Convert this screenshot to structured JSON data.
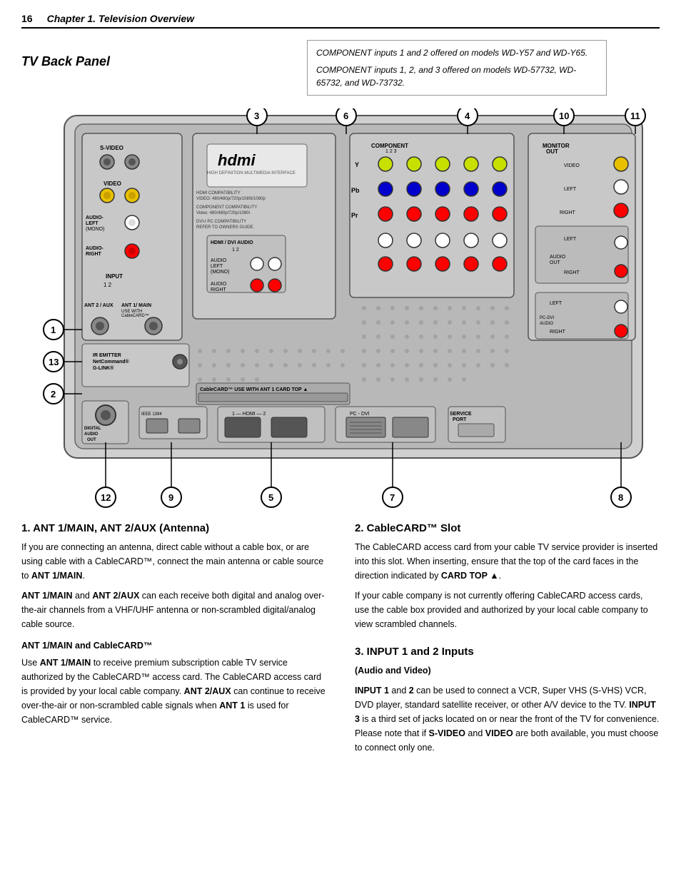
{
  "header": {
    "page_number": "16",
    "chapter_title": "Chapter 1. Television Overview"
  },
  "callout": {
    "line1": "COMPONENT inputs 1 and 2 offered on models WD-Y57 and WD-Y65.",
    "line2": "COMPONENT inputs 1, 2, and 3 offered on models WD-57732, WD-65732, and WD-73732."
  },
  "tv_back_panel": {
    "title": "TV Back Panel"
  },
  "section1": {
    "title": "1.  ANT 1/MAIN, ANT 2/AUX (Antenna)",
    "para1": "If you are connecting an antenna, direct cable without a cable box, or are using cable with a CableCARD™, connect the main antenna or cable source to ANT 1/MAIN.",
    "para2": "ANT 1/MAIN and ANT 2/AUX can each receive both digital and analog over-the-air channels from a VHF/UHF antenna or non-scrambled digital/analog cable source.",
    "subsection_title": "ANT 1/MAIN and CableCARD™",
    "para3": "Use ANT 1/MAIN to receive premium subscription cable TV service authorized by the CableCARD™ access card. The CableCARD access card is provided by your local cable company.  ANT 2/AUX can continue to receive over-the-air or non-scrambled cable signals when ANT 1 is used for CableCARD™ service."
  },
  "section2": {
    "title": "2.  CableCARD™ Slot",
    "para1": "The CableCARD access card from your cable TV service provider is inserted into this slot.  When inserting, ensure that the top of the card faces in the direction indicated by CARD TOP ▲.",
    "para2": "If your cable company is not currently offering CableCARD access cards, use the cable box provided and authorized by your local cable company to view scrambled channels."
  },
  "section3": {
    "title": "3.  INPUT 1 and 2 Inputs",
    "subtitle": "(Audio and Video)",
    "para1": "INPUT 1 and 2 can be used to connect a VCR, Super VHS (S-VHS) VCR, DVD player, standard satellite receiver, or other A/V device to the TV.  INPUT 3 is a third set of jacks located on or near the front of the TV for convenience.  Please note that if S-VIDEO and VIDEO are both available, you must choose to connect only one."
  }
}
